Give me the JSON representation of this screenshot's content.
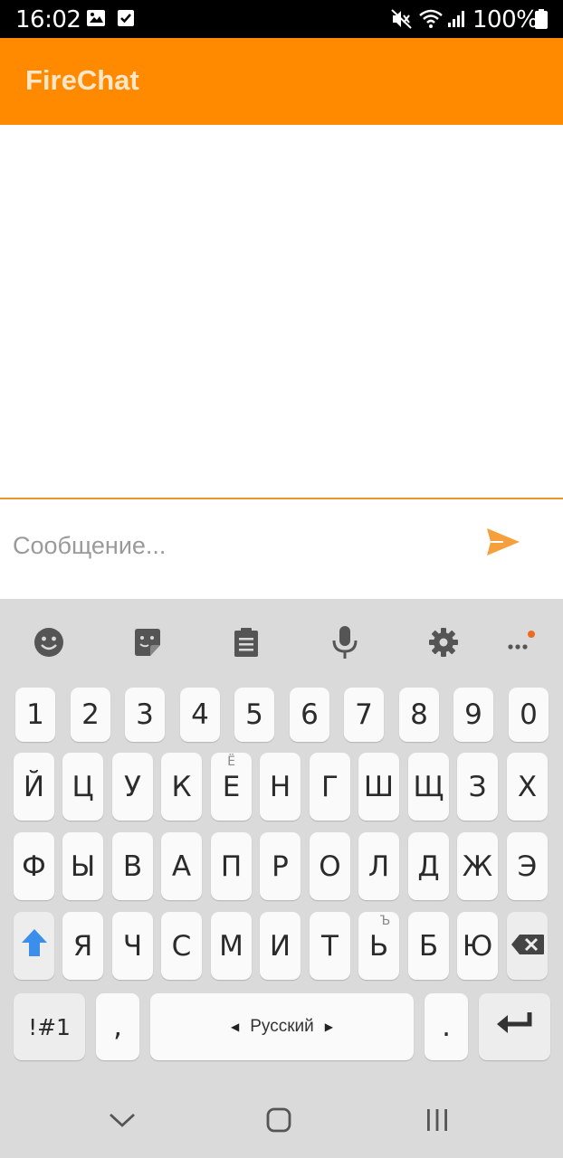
{
  "status_bar": {
    "time": "16:02",
    "battery_percent": "100%",
    "left_icons": [
      "image-icon",
      "checkbox-icon"
    ],
    "right_icons": [
      "mute-icon",
      "wifi-icon",
      "signal-icon",
      "battery-icon"
    ]
  },
  "app_bar": {
    "title": "FireChat",
    "color": "#FF8A00"
  },
  "composer": {
    "placeholder": "Сообщение...",
    "value": "",
    "send_icon": "send-icon",
    "accent": "#F5A03C"
  },
  "keyboard": {
    "toolbar": [
      "emoji-icon",
      "sticker-icon",
      "clipboard-icon",
      "mic-icon",
      "settings-icon",
      "more-icon"
    ],
    "number_row": [
      "1",
      "2",
      "3",
      "4",
      "5",
      "6",
      "7",
      "8",
      "9",
      "0"
    ],
    "row1": [
      "Й",
      "Ц",
      "У",
      "К",
      "Е",
      "Н",
      "Г",
      "Ш",
      "Щ",
      "З",
      "Х"
    ],
    "row1_hint": "Ё",
    "row2": [
      "Ф",
      "Ы",
      "В",
      "А",
      "П",
      "Р",
      "О",
      "Л",
      "Д",
      "Ж",
      "Э"
    ],
    "row3": [
      "Я",
      "Ч",
      "С",
      "М",
      "И",
      "Т",
      "Ь",
      "Б",
      "Ю"
    ],
    "row3_hint": "Ъ",
    "symbols_label": "!#1",
    "comma_label": ",",
    "space_label": "Русский",
    "period_label": ".",
    "shift_color": "#3B8EEA"
  },
  "nav_bar": {
    "buttons": [
      "back-icon",
      "home-icon",
      "recents-icon"
    ]
  }
}
